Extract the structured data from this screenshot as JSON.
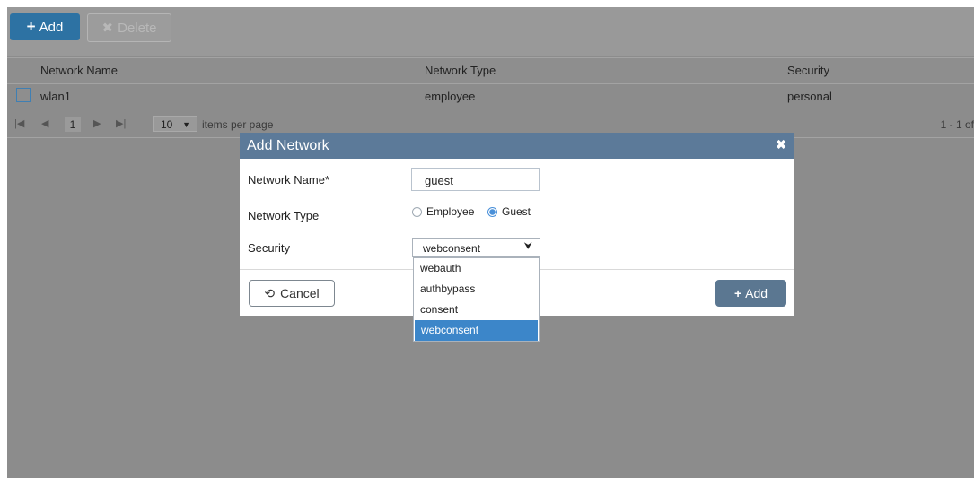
{
  "toolbar": {
    "add_label": "Add",
    "delete_label": "Delete"
  },
  "table": {
    "columns": [
      "Network Name",
      "Network Type",
      "Security"
    ],
    "rows": [
      {
        "name": "wlan1",
        "type": "employee",
        "security": "personal"
      }
    ]
  },
  "pager": {
    "current_page": "1",
    "per_page": "10",
    "per_page_label": "items per page",
    "range": "1 - 1 of"
  },
  "modal": {
    "title": "Add Network",
    "network_name_label": "Network Name*",
    "network_name_value": "guest",
    "network_type_label": "Network Type",
    "type_options": [
      "Employee",
      "Guest"
    ],
    "type_selected": "Guest",
    "security_label": "Security",
    "security_value": "webconsent",
    "security_options": [
      "webauth",
      "authbypass",
      "consent",
      "webconsent"
    ],
    "cancel_label": "Cancel",
    "add_label": "Add"
  },
  "colors": {
    "primary": "#2d72a3",
    "modal_header": "#5c7a99",
    "selected_option": "#3c86c9"
  }
}
